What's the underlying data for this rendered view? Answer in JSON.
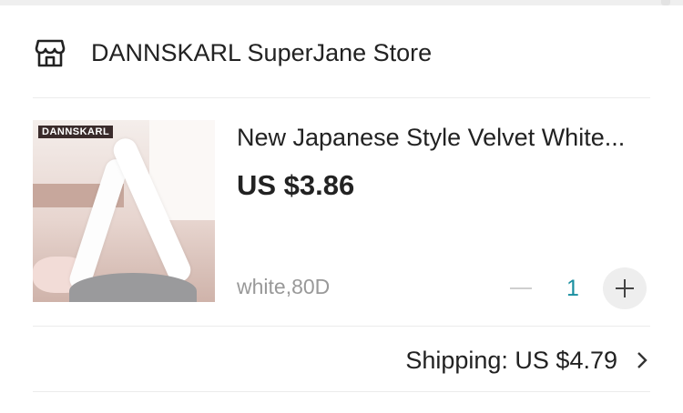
{
  "store": {
    "name": "DANNSKARL SuperJane Store",
    "icon": "store-icon"
  },
  "product": {
    "title": "New Japanese Style Velvet White...",
    "price": "US $3.86",
    "variant": "white,80D",
    "quantity": "1",
    "image_brand_text": "DANNSKARL"
  },
  "stepper": {
    "minus_icon": "minus-icon",
    "plus_icon": "plus-icon"
  },
  "shipping": {
    "text": "Shipping: US $4.79",
    "icon": "chevron-right-icon"
  },
  "colors": {
    "quantity": "#1a8fa0",
    "variant_text": "#999999",
    "divider": "#ececec"
  }
}
